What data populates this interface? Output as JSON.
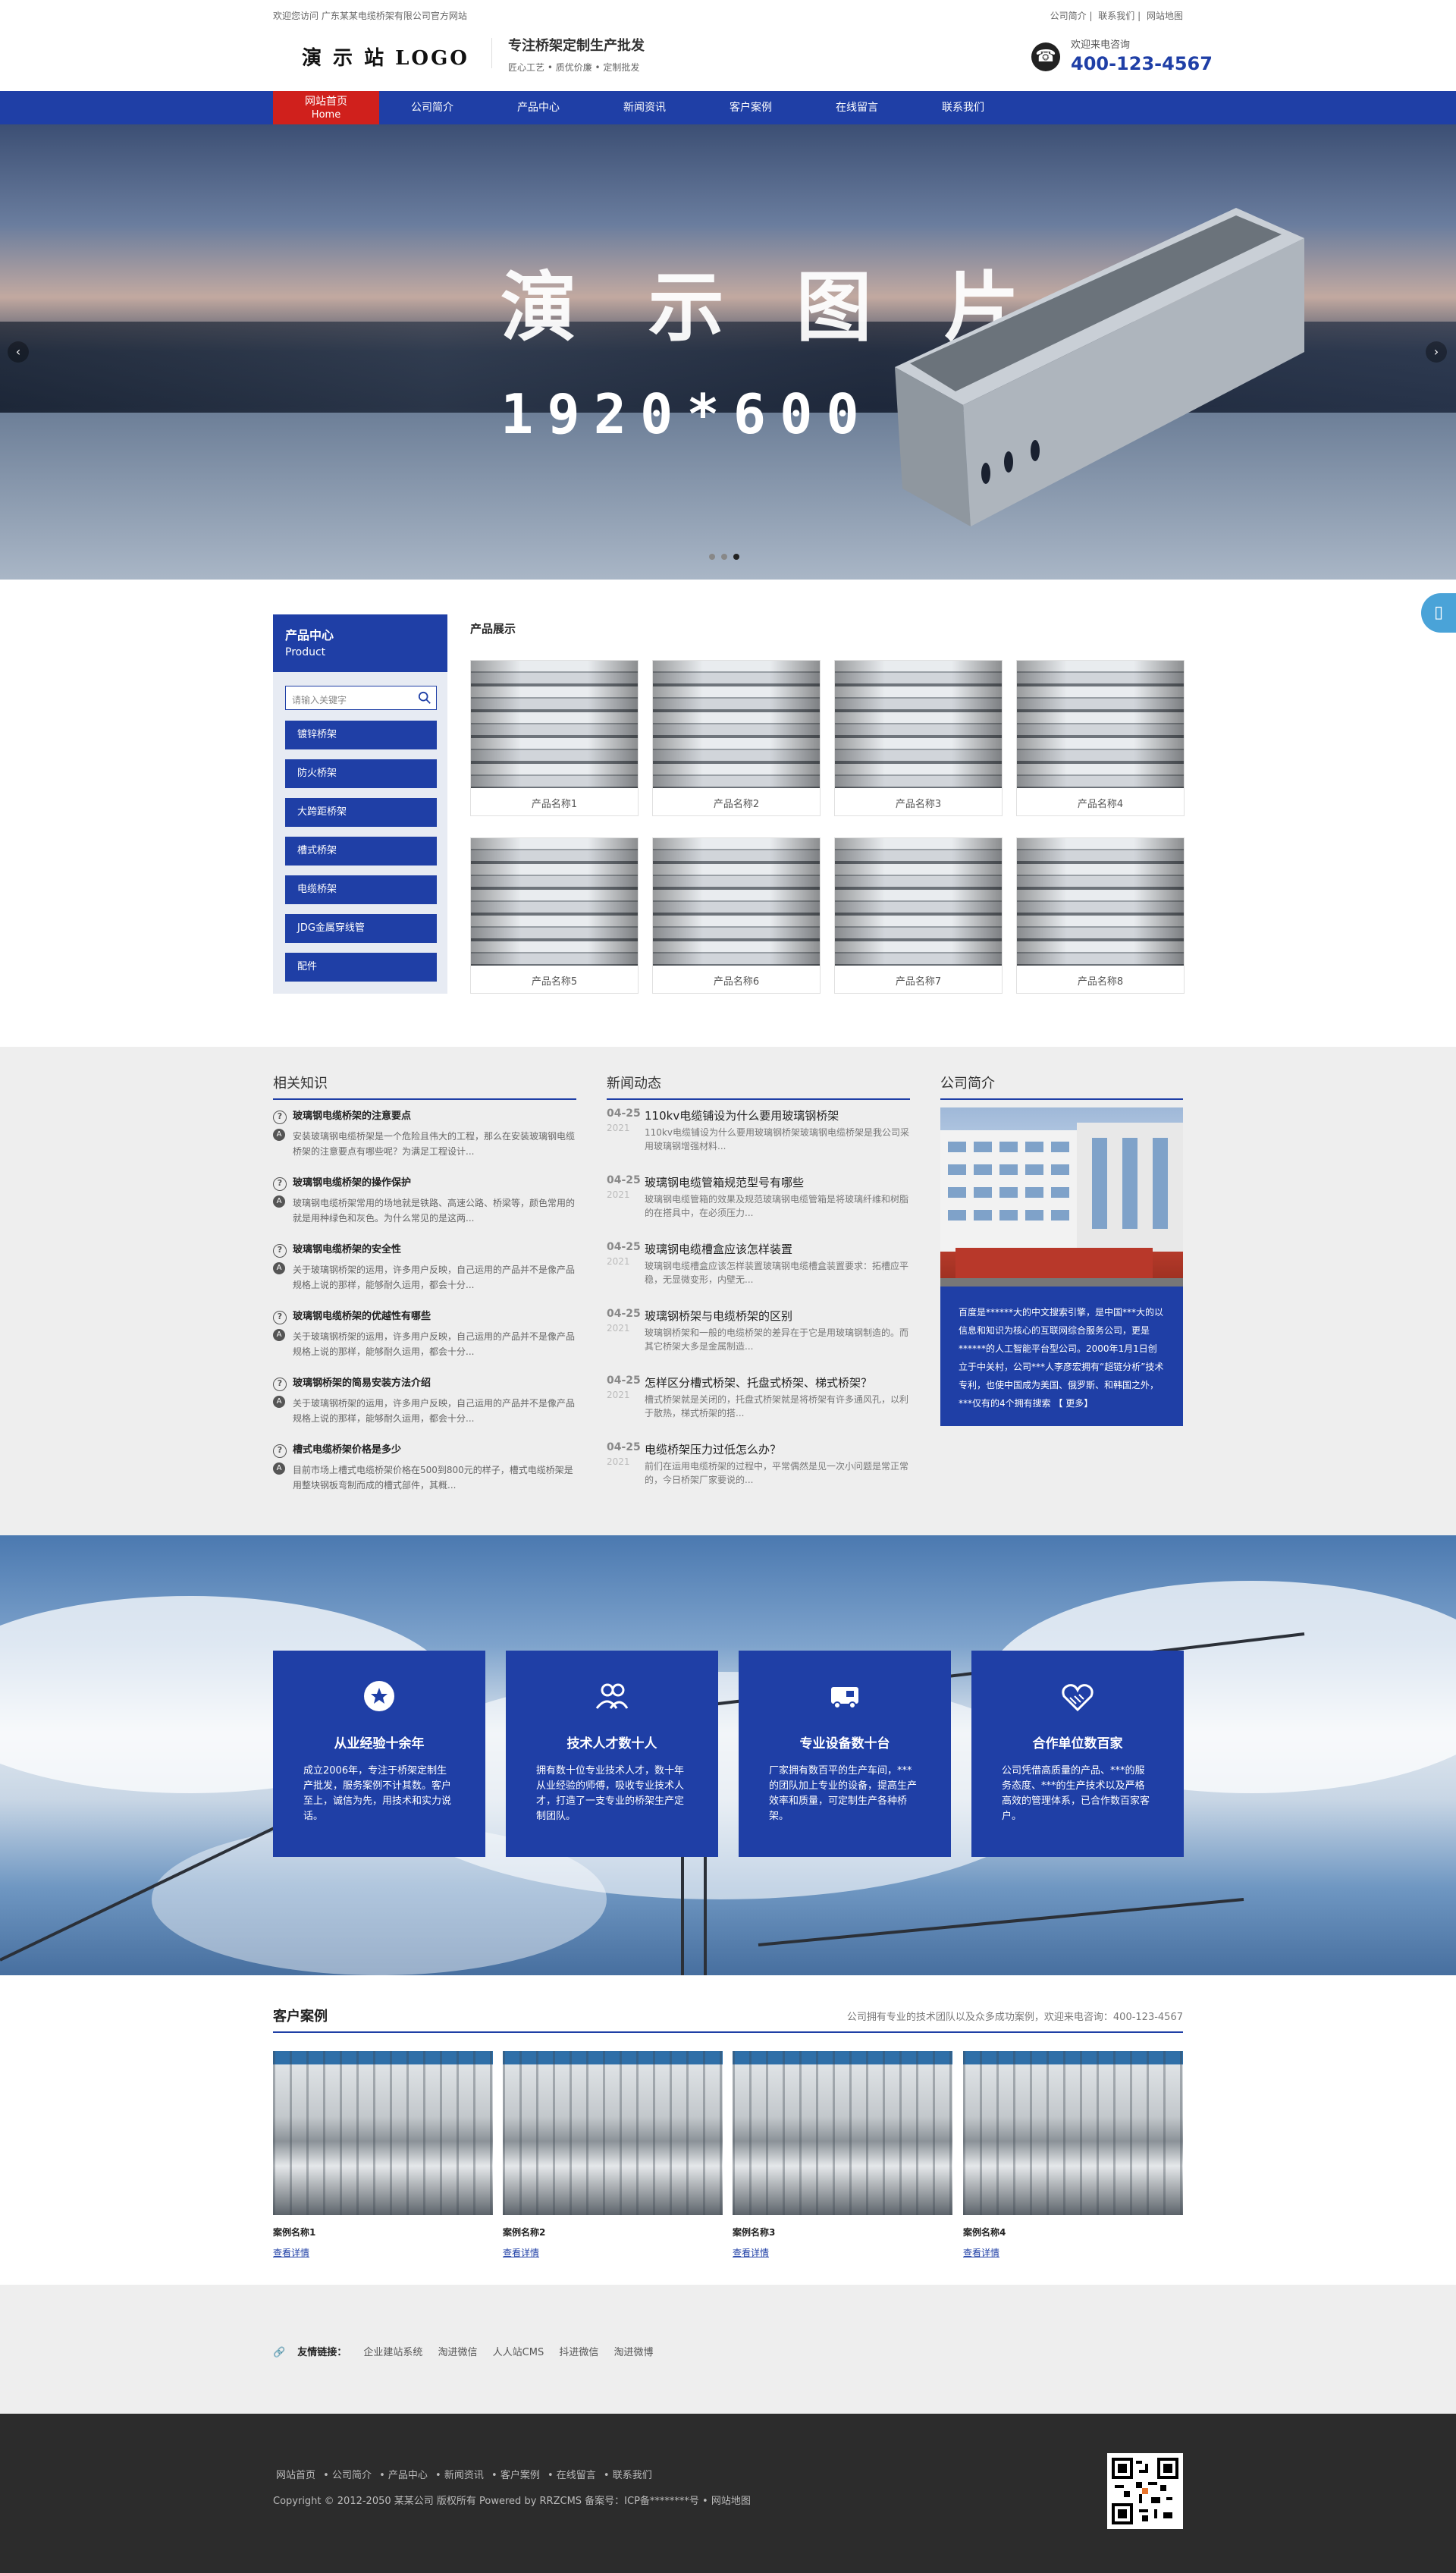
{
  "topbar": {
    "welcome": "欢迎您访问 广东某某电缆桥架有限公司官方网站",
    "links": [
      "公司简介",
      "联系我们",
      "网站地图"
    ]
  },
  "header": {
    "logo": "演 示 站 LOGO",
    "slogan_title": "专注桥架定制生产批发",
    "slogan_sub": "匠心工艺 • 质优价廉 • 定制批发",
    "hotline_label": "欢迎来电咨询",
    "hotline_number": "400-123-4567"
  },
  "nav": {
    "home": "网站首页",
    "home_en": "Home",
    "items": [
      "公司简介",
      "产品中心",
      "新闻资讯",
      "客户案例",
      "在线留言",
      "联系我们"
    ]
  },
  "banner": {
    "title": "演 示 图 片",
    "size": "1920*600",
    "prev": "‹",
    "next": "›"
  },
  "products": {
    "side_title": "产品中心",
    "side_title_en": "Product",
    "search_placeholder": "请输入关键字",
    "categories": [
      "镀锌桥架",
      "防火桥架",
      "大跨距桥架",
      "槽式桥架",
      "电缆桥架",
      "JDG金属穿线管",
      "配件"
    ],
    "section_title": "产品展示",
    "items": [
      "产品名称1",
      "产品名称2",
      "产品名称3",
      "产品名称4",
      "产品名称5",
      "产品名称6",
      "产品名称7",
      "产品名称8"
    ]
  },
  "knowledge": {
    "title": "相关知识",
    "items": [
      {
        "q": "玻璃钢电缆桥架的注意要点",
        "a": "安装玻璃钢电缆桥架是一个危险且伟大的工程，那么在安装玻璃钢电缆桥架的注意要点有哪些呢？为满足工程设计..."
      },
      {
        "q": "玻璃钢电缆桥架的操作保护",
        "a": "玻璃钢电缆桥架常用的场地就是铁路、高速公路、桥梁等，颜色常用的就是用种绿色和灰色。为什么常见的是这两..."
      },
      {
        "q": "玻璃钢电缆桥架的安全性",
        "a": "关于玻璃钢桥架的运用，许多用户反映，自己运用的产品并不是像产品规格上说的那样，能够耐久运用，都会十分..."
      },
      {
        "q": "玻璃钢电缆桥架的优越性有哪些",
        "a": "关于玻璃钢桥架的运用，许多用户反映，自己运用的产品并不是像产品规格上说的那样，能够耐久运用，都会十分..."
      },
      {
        "q": "玻璃钢桥架的简易安装方法介绍",
        "a": "关于玻璃钢桥架的运用，许多用户反映，自己运用的产品并不是像产品规格上说的那样，能够耐久运用，都会十分..."
      },
      {
        "q": "槽式电缆桥架价格是多少",
        "a": "目前市场上槽式电缆桥架价格在500到800元的样子，槽式电缆桥架是用整块钢板弯制而成的槽式部件，其概..."
      }
    ]
  },
  "news": {
    "title": "新闻动态",
    "items": [
      {
        "d": "04-25",
        "y": "2021",
        "t": "110kv电缆铺设为什么要用玻璃钢桥架",
        "s": "110kv电缆铺设为什么要用玻璃钢桥架玻璃钢电缆桥架是我公司采用玻璃钢增强材料..."
      },
      {
        "d": "04-25",
        "y": "2021",
        "t": "玻璃钢电缆管箱规范型号有哪些",
        "s": "玻璃钢电缆管箱的效果及规范玻璃钢电缆管箱是将玻璃纤维和树脂的在搭具中，在必须压力..."
      },
      {
        "d": "04-25",
        "y": "2021",
        "t": "玻璃钢电缆槽盒应该怎样装置",
        "s": "玻璃钢电缆槽盒应该怎样装置玻璃钢电缆槽盒装置要求：拓槽应平稳，无显微变形，内壁无..."
      },
      {
        "d": "04-25",
        "y": "2021",
        "t": "玻璃钢桥架与电缆桥架的区别",
        "s": "玻璃钢桥架和一般的电缆桥架的差异在于它是用玻璃钢制造的。而其它桥架大多是金属制造..."
      },
      {
        "d": "04-25",
        "y": "2021",
        "t": "怎样区分槽式桥架、托盘式桥架、梯式桥架？",
        "s": "槽式桥架就是关闭的，托盘式桥架就是将桥架有许多通风孔，以利于散热，梯式桥架的搭..."
      },
      {
        "d": "04-25",
        "y": "2021",
        "t": "电缆桥架压力过低怎么办？",
        "s": "前们在运用电缆桥架的过程中，平常偶然是见一次小问题是常正常的，今日桥架厂家要说的..."
      }
    ]
  },
  "about": {
    "title": "公司简介",
    "text": "百度是******大的中文搜索引擎，是中国***大的以信息和知识为核心的互联网综合服务公司，更是******的人工智能平台型公司。2000年1月1日创立于中关村，公司***人李彦宏拥有“超链分析”技术专利，也使中国成为美国、俄罗斯、和韩国之外，***仅有的4个拥有搜索",
    "more": "【 更多】"
  },
  "features": [
    {
      "icon": "star-icon",
      "t": "从业经验十余年",
      "s": "成立2006年，专注于桥架定制生产批发，服务案例不计其数。客户至上，诚信为先，用技术和实力说话。"
    },
    {
      "icon": "team-icon",
      "t": "技术人才数十人",
      "s": "拥有数十位专业技术人才，数十年从业经验的师傅，吸收专业技术人才，打造了一支专业的桥架生产定制团队。"
    },
    {
      "icon": "truck-icon",
      "t": "专业设备数十台",
      "s": "厂家拥有数百平的生产车间，***的团队加上专业的设备，提高生产效率和质量，可定制生产各种桥架。"
    },
    {
      "icon": "handshake-icon",
      "t": "合作单位数百家",
      "s": "公司凭借高质量的产品、***的服务态度、***的生产技术以及严格高效的管理体系，已合作数百家客户。"
    }
  ],
  "cases": {
    "title": "客户案例",
    "subtitle": "公司拥有专业的技术团队以及众多成功案例，欢迎来电咨询：400-123-4567",
    "items": [
      "案例名称1",
      "案例名称2",
      "案例名称3",
      "案例名称4"
    ],
    "more": "查看详情"
  },
  "friend_links": {
    "label": "友情链接：",
    "items": [
      "企业建站系统",
      "淘进微信",
      "人人站CMS",
      "抖进微信",
      "淘进微博"
    ]
  },
  "footer": {
    "nav": [
      "网站首页",
      "公司简介",
      "产品中心",
      "新闻资讯",
      "客户案例",
      "在线留言",
      "联系我们"
    ],
    "copyright": "Copyright © 2012-2050 某某公司 版权所有 Powered by RRZCMS 备案号：ICP备********号 • 网站地图"
  },
  "colors": {
    "primary": "#1f3fa6",
    "accent": "#d0201c",
    "float": "#4aa3d8"
  }
}
